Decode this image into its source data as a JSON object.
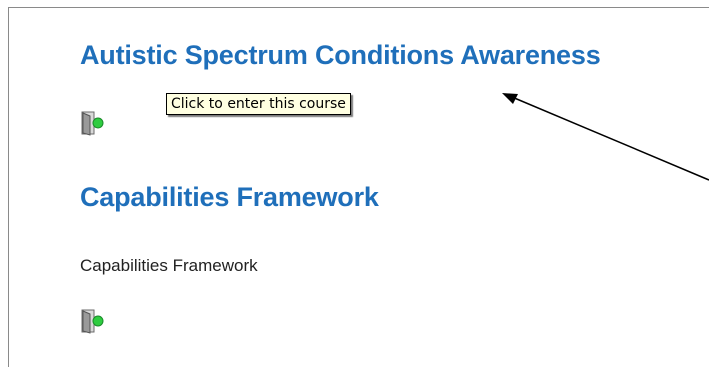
{
  "courses": [
    {
      "title": "Autistic Spectrum Conditions Awareness",
      "icon": "enter-course-icon"
    },
    {
      "title": "Capabilities Framework",
      "description": "Capabilities Framework",
      "icon": "enter-course-icon"
    }
  ],
  "tooltip": {
    "text": "Click to enter this course"
  },
  "colors": {
    "link": "#1f6fba",
    "tooltip_bg": "#ffffe1",
    "icon_arrow": "#2ecc40"
  }
}
